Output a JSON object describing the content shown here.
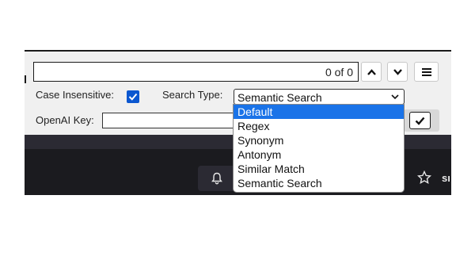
{
  "find_bar": {
    "search_value": "",
    "match_count": "0 of 0",
    "prev_icon": "chevron-up-icon",
    "next_icon": "chevron-down-icon",
    "menu_icon": "hamburger-menu-icon"
  },
  "options": {
    "case_insensitive_label": "Case Insensitive:",
    "case_insensitive_checked": true,
    "search_type_label": "Search Type:",
    "search_type_value": "Semantic Search",
    "search_type_options": [
      "Default",
      "Regex",
      "Synonym",
      "Antonym",
      "Similar Match",
      "Semantic Search"
    ],
    "highlighted_option": "Default",
    "openai_key_label": "OpenAI Key:",
    "openai_key_value": "",
    "confirm_icon": "checkmark-icon"
  },
  "browser_toolbar": {
    "bell_icon": "bell-icon",
    "star_icon": "star-icon",
    "cut_text": "sı"
  },
  "colors": {
    "accent": "#1a73e8",
    "checkbox": "#0b57d0",
    "panel_bg": "#f0f0f0",
    "dark_bg": "#1b1b1f"
  }
}
